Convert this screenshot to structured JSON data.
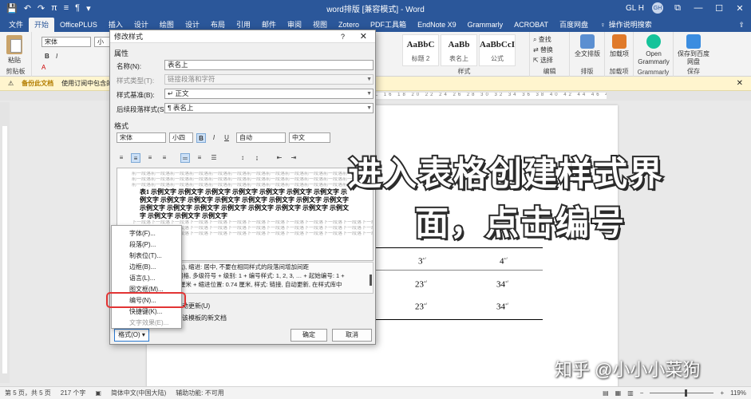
{
  "titlebar": {
    "qat": [
      "💾",
      "↶",
      "↷",
      "π",
      "≡",
      "¶",
      "▾"
    ],
    "title": "word排版 [兼容模式] - Word",
    "user_initials": "GL H",
    "avatar_text": "GH",
    "win_icon": "⧉",
    "min": "—",
    "max": "☐",
    "close": "✕"
  },
  "tabs": [
    "文件",
    "开始",
    "OfficePLUS",
    "插入",
    "设计",
    "绘图",
    "设计",
    "布局",
    "引用",
    "邮件",
    "审阅",
    "视图",
    "Zotero",
    "PDF工具箱",
    "EndNote X9",
    "Grammarly",
    "ACROBAT",
    "百度网盘"
  ],
  "tab_active_index": 1,
  "tab_search": "操作说明搜索",
  "share_icon": "⇪",
  "ribbon": {
    "paste": "粘贴",
    "clipboard": "剪贴板",
    "font_name": "宋体",
    "font_size": "小",
    "style_cards": [
      {
        "sample": "AaBbC",
        "name": "标题 2"
      },
      {
        "sample": "AaBb",
        "name": "表名上"
      },
      {
        "sample": "AaBbCcI",
        "name": "公式"
      }
    ],
    "styles_label": "样式",
    "find": "查找",
    "replace": "替换",
    "select": "选择",
    "editing_label": "编辑",
    "layout_cmd": "全文排版",
    "layout_label": "排版",
    "addin_cmd": "加载项",
    "addin_label": "加载项",
    "grammarly_cmd": "Open Grammarly",
    "grammarly_label": "Grammarly",
    "baidu_cmd": "保存到百度网盘",
    "baidu_label": "保存"
  },
  "msgbar": {
    "label": "备份此文档",
    "text": "使用订阅中包含的 O",
    "close": "✕"
  },
  "ruler_text": "L 16 18 20 22 24 26 28 30 32 34 36 38 40 42 44 46 48",
  "document": {
    "cells": [
      "3",
      "4",
      "23",
      "34",
      "23",
      "34"
    ],
    "mark": "↵"
  },
  "overlay": {
    "line1": "进入表格创建样式界",
    "line2": "面，点击编号",
    "watermark": "知乎 @小小小菜狗"
  },
  "statusbar": {
    "page": "第 5 页，共 5 页",
    "words": "217 个字",
    "lang": "简体中文(中国大陆)",
    "access": "辅助功能: 不可用",
    "zoom": "119%",
    "zoom_level_pct": 55
  },
  "dialog": {
    "title": "修改样式",
    "help": "?",
    "close": "✕",
    "props_section": "属性",
    "name_label": "名称(N):",
    "name_value": "表名上",
    "type_label": "样式类型(T):",
    "type_value": "链接段落和字符",
    "based_label": "样式基准(B):",
    "based_value": "↵ 正文",
    "next_label": "后续段落样式(S):",
    "next_value": "¶ 表名上",
    "format_section": "格式",
    "font": "宋体",
    "size": "小四",
    "bold": "B",
    "italic": "I",
    "underline": "U",
    "color": "自动",
    "script": "中文",
    "preview_gray": "前一段落前一段落前一段落前一段落前一段落前一段落前一段落前一段落前一段落前一段落前一段落前一段落前一段落前一段落前一段落前一段落前一段落前一段落前一段落前一段落",
    "preview_main": "表1 示例文字 示例文字 示例文字 示例文字 示例文字 示例文字 示例文字 示例文字 示例文字 示例文字 示例文字 示例文字 示例文字 示例文字 示例文字 示例文字 示例文字 示例文字 示例文字 示例文字 示例文字 示例文字 示例文字 示例文字 示例文字 示例文字",
    "preview_after": "下一段落下一段落下一段落下一段落下一段落下一段落下一段落下一段落下一段落下一段落下一段落下一段落下一段落下一段落下一段落下一段落下一段落下一段落下一段落下一段落",
    "desc_line1": "国大陆), 缩进: 居中, 不要在相同样式的段落间增加间距",
    "desc_line2": "齐到网格, 多级符号 + 级别: 1 + 编号样式: 1, 2, 3, … + 起始编号: 1 +",
    "desc_line3": "置: 0 厘米 + 缩进位置: 0.74 厘米, 样式: 链接, 自动更新, 在样式库中",
    "auto_update": "动更新(U)",
    "template": "该模板的新文档",
    "format_btn": "格式(O)",
    "ok": "确定",
    "cancel": "取消"
  },
  "menu": {
    "items": [
      "字体(F)...",
      "段落(P)...",
      "制表位(T)...",
      "边框(B)...",
      "语言(L)...",
      "图文框(M)...",
      "编号(N)...",
      "快捷键(K)...",
      "文字效果(E)..."
    ],
    "disabled": [
      false,
      false,
      false,
      false,
      false,
      false,
      false,
      false,
      true
    ]
  },
  "colors": {
    "word_blue": "#2b579a",
    "highlight": "#e23434"
  }
}
